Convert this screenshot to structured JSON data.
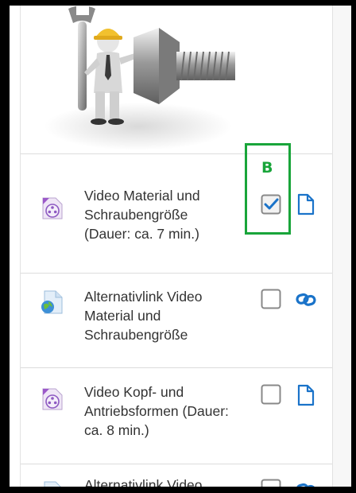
{
  "activities": [
    {
      "label_lines": [
        "Video Material und",
        "Schraubengröße",
        "(Dauer: ca. 7 min.)"
      ],
      "type_icon": "video-file-icon",
      "checked": true,
      "action_icon": "file-icon"
    },
    {
      "label_lines": [
        "Alternativlink Video",
        "Material und",
        "Schraubengröße"
      ],
      "type_icon": "url-globe-icon",
      "checked": false,
      "action_icon": "link-icon"
    },
    {
      "label_lines": [
        "Video Kopf- und",
        "Antriebsformen (Dauer:",
        "ca. 8 min.)"
      ],
      "type_icon": "video-file-icon",
      "checked": false,
      "action_icon": "file-icon"
    },
    {
      "label_lines": [
        "Alternativlink Video"
      ],
      "type_icon": "url-globe-icon",
      "checked": false,
      "action_icon": "link-icon"
    }
  ],
  "annotation": {
    "label": "B",
    "color": "#19a53a"
  },
  "colors": {
    "accent_blue": "#1a73c9",
    "video_icon_purple": "#9b59c9"
  }
}
